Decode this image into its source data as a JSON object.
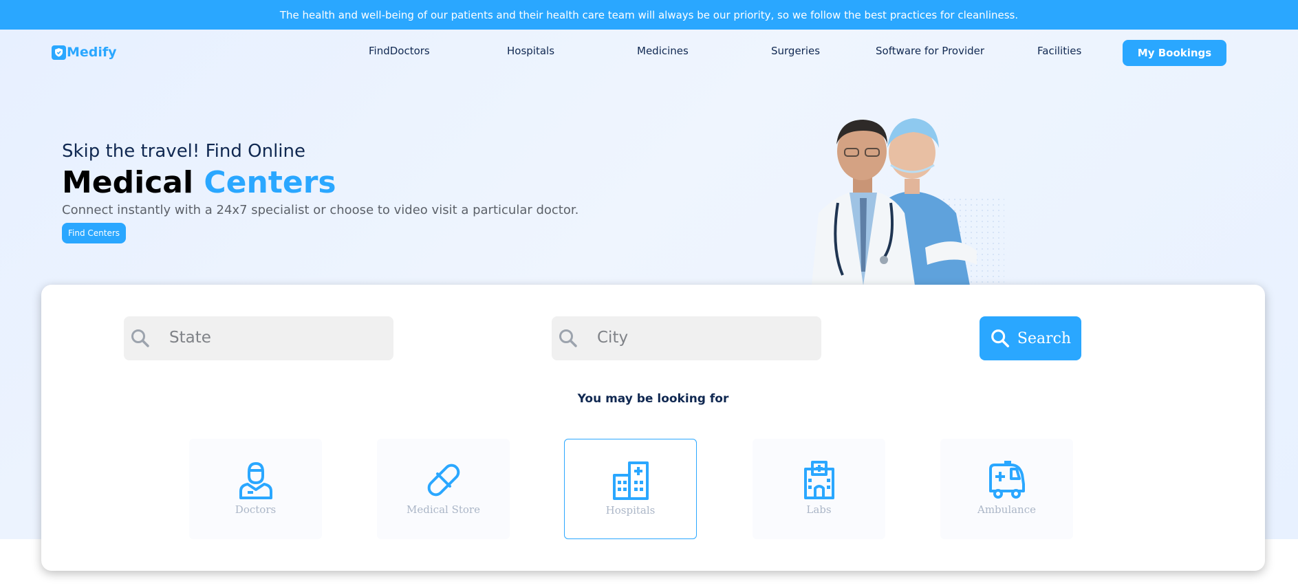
{
  "announcement": "The health and well-being of our patients and their health care team will always be our priority, so we follow the best practices for cleanliness.",
  "brand": {
    "name": "Medify",
    "icon": "shield-logo-icon",
    "color": "#2AA7FF"
  },
  "nav": {
    "items": [
      "FindDoctors",
      "Hospitals",
      "Medicines",
      "Surgeries",
      "Software for Provider",
      "Facilities"
    ],
    "cta": "My Bookings"
  },
  "hero": {
    "subtitle": "Skip the travel! Find Online",
    "title_main": "Medical",
    "title_accent": "Centers",
    "description": "Connect instantly with a 24x7 specialist or choose to video visit a particular doctor.",
    "button": "Find Centers",
    "image": "doctor-and-nurse-photo"
  },
  "search": {
    "state_placeholder": "State",
    "city_placeholder": "City",
    "button": "Search",
    "icon": "search-icon"
  },
  "categories": {
    "heading": "You may be looking for",
    "items": [
      {
        "label": "Doctors",
        "icon": "doctor-icon",
        "selected": false
      },
      {
        "label": "Medical Store",
        "icon": "pill-icon",
        "selected": false
      },
      {
        "label": "Hospitals",
        "icon": "hospital-icon",
        "selected": true
      },
      {
        "label": "Labs",
        "icon": "lab-icon",
        "selected": false
      },
      {
        "label": "Ambulance",
        "icon": "ambulance-icon",
        "selected": false
      }
    ]
  },
  "colors": {
    "accent": "#2AA7FF",
    "heading": "#102851",
    "muted": "#ABB6C7"
  }
}
